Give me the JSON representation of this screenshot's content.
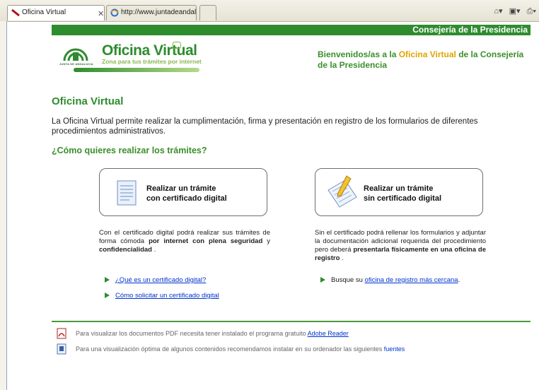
{
  "browser": {
    "tabs": [
      {
        "label": "Oficina Virtual"
      },
      {
        "label": "http://www.juntadeandaluci..."
      },
      {
        "label": ""
      }
    ],
    "tab_close": "✕",
    "toolbar_icons": [
      "home-icon",
      "feeds-icon",
      "print-icon"
    ]
  },
  "header": {
    "department": "Consejería de la Presidencia",
    "logo": {
      "junta": "JUNTA DE ANDALUCIA",
      "title": "Oficina Virtual",
      "subtitle": "Zona para tus trámites por internet"
    },
    "welcome_prefix": "Bienvenidos/as a la ",
    "welcome_highlight": "Oficina Virtual",
    "welcome_suffix": " de la Consejería de la Presidencia"
  },
  "main": {
    "title": "Oficina Virtual",
    "intro": "La Oficina Virtual permite realizar la cumplimentación, firma y presentación en registro de los formularios de diferentes procedimientos administrativos.",
    "question": "¿Cómo quieres realizar los trámites?"
  },
  "options": [
    {
      "line1": "Realizar un trámite",
      "line2": "con certificado digital",
      "desc_a": "Con el certificado digital podrá realizar sus trámites de forma cómoda ",
      "desc_b": "por internet con plena seguridad",
      "desc_c": " y ",
      "desc_d": "confidencialidad",
      "desc_e": " .",
      "links": [
        "¿Qué es un certificado digital?",
        "Cómo solicitar un certificado digital"
      ]
    },
    {
      "line1": "Realizar un trámite",
      "line2": "sin certificado digital",
      "desc_a": "Sin el certificado podrá rellenar los formularios y adjuntar la documentación adicional requerida del procedimiento pero deberá ",
      "desc_b": "presentarla físicamente en una oficina de registro",
      "desc_c": " .",
      "link_prefix": "Busque su ",
      "link": "oficina de registro más cercana",
      "link_suffix": "."
    }
  ],
  "footer": {
    "pdf_text": "Para visualizar los documentos PDF necesita tener instalado el programa gratuito ",
    "pdf_link": "Adobe Reader",
    "fonts_text": "Para una visualización óptima de algunos contenidos recomendamos instalar en su ordenador las siguientes ",
    "fonts_link": "fuentes"
  },
  "colors": {
    "brand_green": "#2e8c2e",
    "highlight_yellow": "#e0a400",
    "link_blue": "#0033cc"
  }
}
